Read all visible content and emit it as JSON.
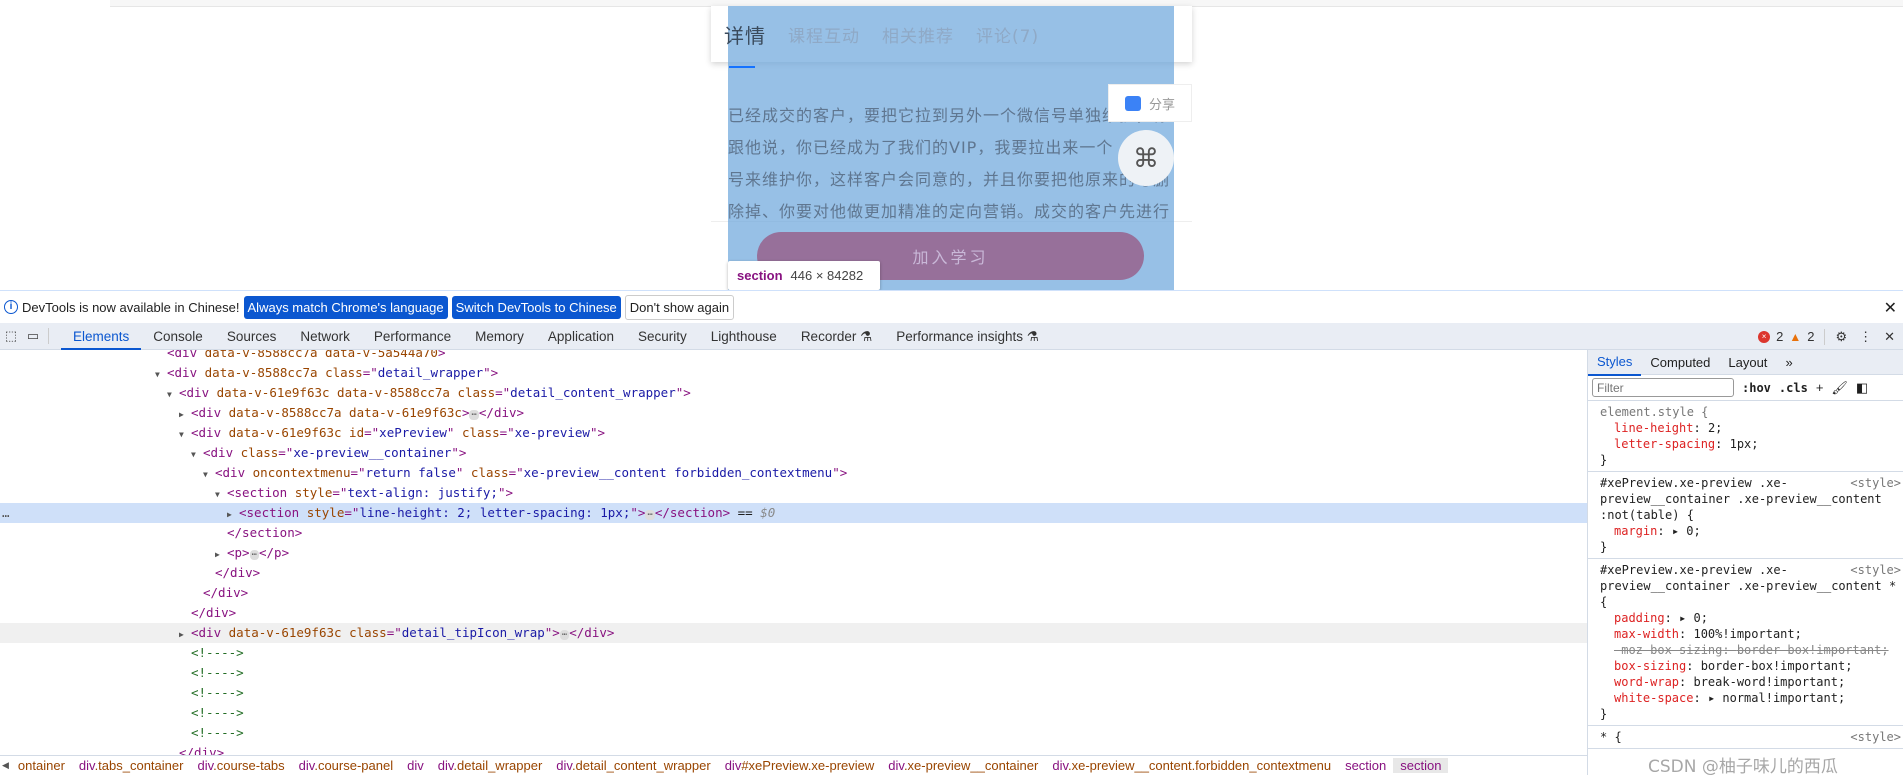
{
  "page": {
    "tabs": [
      "详情",
      "课程互动",
      "相关推荐",
      "评论(7)"
    ],
    "body_lines": [
      "已经成交的客户，要把它拉到另外一个微信号单独维护，你",
      "跟他说，你已经成为了我们的VIP，我要拉出来一个",
      "号来维护你，这样客户会同意的，并且你要把他原来的号删",
      "除掉、你要对他做更加精准的定向营销。成交的客户先进行"
    ],
    "share_label": "分享",
    "join_button": "加入学习",
    "tooltip": {
      "tag": "section",
      "size": "446 × 84282"
    },
    "highlight_color": "#6fa8dc"
  },
  "infobar": {
    "message": "DevTools is now available in Chinese!",
    "buttons": [
      "Always match Chrome's language",
      "Switch DevTools to Chinese",
      "Don't show again"
    ]
  },
  "toolbar": {
    "tabs": [
      "Elements",
      "Console",
      "Sources",
      "Network",
      "Performance",
      "Memory",
      "Application",
      "Security",
      "Lighthouse",
      "Recorder ⚗",
      "Performance insights ⚗"
    ],
    "active": "Elements",
    "errors": "2",
    "warnings": "2"
  },
  "elements": {
    "rows": [
      {
        "i": 10,
        "t": [
          [
            "tag",
            "<div "
          ],
          [
            "an",
            "data-v-8588cc7a data-v-5a544a70"
          ],
          [
            "tag",
            ">"
          ]
        ]
      },
      {
        "i": 10,
        "tri": "▼",
        "t": [
          [
            "tag",
            "<div "
          ],
          [
            "an",
            "data-v-8588cc7a "
          ],
          [
            "an",
            "class"
          ],
          [
            "tag",
            "=\""
          ],
          [
            "av",
            "detail_wrapper"
          ],
          [
            "tag",
            "\">"
          ]
        ]
      },
      {
        "i": 11,
        "tri": "▼",
        "t": [
          [
            "tag",
            "<div "
          ],
          [
            "an",
            "data-v-61e9f63c data-v-8588cc7a "
          ],
          [
            "an",
            "class"
          ],
          [
            "tag",
            "=\""
          ],
          [
            "av",
            "detail_content_wrapper"
          ],
          [
            "tag",
            "\">"
          ]
        ]
      },
      {
        "i": 12,
        "tri": "▶",
        "t": [
          [
            "tag",
            "<div "
          ],
          [
            "an",
            "data-v-8588cc7a data-v-61e9f63c"
          ],
          [
            "tag",
            ">"
          ],
          [
            "ell",
            "⋯"
          ],
          [
            "tag",
            "</div>"
          ]
        ]
      },
      {
        "i": 12,
        "tri": "▼",
        "t": [
          [
            "tag",
            "<div "
          ],
          [
            "an",
            "data-v-61e9f63c id"
          ],
          [
            "tag",
            "=\""
          ],
          [
            "av",
            "xePreview"
          ],
          [
            "tag",
            "\" "
          ],
          [
            "an",
            "class"
          ],
          [
            "tag",
            "=\""
          ],
          [
            "av",
            "xe-preview"
          ],
          [
            "tag",
            "\">"
          ]
        ]
      },
      {
        "i": 13,
        "tri": "▼",
        "t": [
          [
            "tag",
            "<div "
          ],
          [
            "an",
            "class"
          ],
          [
            "tag",
            "=\""
          ],
          [
            "av",
            "xe-preview__container"
          ],
          [
            "tag",
            "\">"
          ]
        ]
      },
      {
        "i": 14,
        "tri": "▼",
        "t": [
          [
            "tag",
            "<div "
          ],
          [
            "an",
            "oncontextmenu"
          ],
          [
            "tag",
            "=\""
          ],
          [
            "av",
            "return false"
          ],
          [
            "tag",
            "\" "
          ],
          [
            "an",
            "class"
          ],
          [
            "tag",
            "=\""
          ],
          [
            "av",
            "xe-preview__content forbidden_contextmenu"
          ],
          [
            "tag",
            "\">"
          ]
        ]
      },
      {
        "i": 15,
        "tri": "▼",
        "t": [
          [
            "tag",
            "<section "
          ],
          [
            "an",
            "style"
          ],
          [
            "tag",
            "=\""
          ],
          [
            "av",
            "text-align: justify;"
          ],
          [
            "tag",
            "\">"
          ]
        ]
      },
      {
        "i": 16,
        "tri": "▶",
        "sel": true,
        "t": [
          [
            "tag",
            "<section "
          ],
          [
            "an",
            "style"
          ],
          [
            "tag",
            "=\""
          ],
          [
            "av",
            "line-height: 2; letter-spacing: 1px;"
          ],
          [
            "tag",
            "\">"
          ],
          [
            "ell",
            "⋯"
          ],
          [
            "tag",
            "</section>"
          ],
          [
            "tx",
            " == "
          ],
          [
            "ref",
            "$0"
          ]
        ]
      },
      {
        "i": 15,
        "t": [
          [
            "tag",
            "</section>"
          ]
        ]
      },
      {
        "i": 15,
        "tri": "▶",
        "t": [
          [
            "tag",
            "<p>"
          ],
          [
            "ell",
            "⋯"
          ],
          [
            "tag",
            "</p>"
          ]
        ]
      },
      {
        "i": 14,
        "t": [
          [
            "tag",
            "</div>"
          ]
        ]
      },
      {
        "i": 13,
        "t": [
          [
            "tag",
            "</div>"
          ]
        ]
      },
      {
        "i": 12,
        "t": [
          [
            "tag",
            "</div>"
          ]
        ]
      },
      {
        "i": 12,
        "tri": "▶",
        "hov": true,
        "t": [
          [
            "tag",
            "<div "
          ],
          [
            "an",
            "data-v-61e9f63c "
          ],
          [
            "an",
            "class"
          ],
          [
            "tag",
            "=\""
          ],
          [
            "av",
            "detail_tipIcon_wrap"
          ],
          [
            "tag",
            "\">"
          ],
          [
            "ell",
            "⋯"
          ],
          [
            "tag",
            "</div>"
          ]
        ]
      },
      {
        "i": 12,
        "t": [
          [
            "cm",
            "<!---->"
          ]
        ]
      },
      {
        "i": 12,
        "t": [
          [
            "cm",
            "<!---->"
          ]
        ]
      },
      {
        "i": 12,
        "t": [
          [
            "cm",
            "<!---->"
          ]
        ]
      },
      {
        "i": 12,
        "t": [
          [
            "cm",
            "<!---->"
          ]
        ]
      },
      {
        "i": 12,
        "t": [
          [
            "cm",
            "<!---->"
          ]
        ]
      },
      {
        "i": 11,
        "t": [
          [
            "tag",
            "</div>"
          ]
        ]
      }
    ]
  },
  "breadcrumb": [
    [
      "",
      "ontainer"
    ],
    [
      "div",
      ".tabs_container"
    ],
    [
      "div",
      ".course-tabs"
    ],
    [
      "div",
      ".course-panel"
    ],
    [
      "div",
      ""
    ],
    [
      "div",
      ".detail_wrapper"
    ],
    [
      "div",
      ".detail_content_wrapper"
    ],
    [
      "div",
      "#xePreview.xe-preview"
    ],
    [
      "div",
      ".xe-preview__container"
    ],
    [
      "div",
      ".xe-preview__content.forbidden_contextmenu"
    ],
    [
      "section",
      ""
    ],
    [
      "section",
      ""
    ]
  ],
  "styles": {
    "tabs": [
      "Styles",
      "Computed",
      "Layout",
      "»"
    ],
    "filter_placeholder": "Filter",
    "hov": ":hov",
    "cls": ".cls",
    "rules": [
      {
        "selector": "element.style {",
        "dim": true,
        "source": "",
        "props": [
          [
            "line-height",
            "2;",
            false
          ],
          [
            "letter-spacing",
            "1px;",
            false
          ]
        ]
      },
      {
        "selector": "#xePreview.xe-preview .xe-preview__container .xe-preview__content :not(table) {",
        "source": "<style>",
        "props": [
          [
            "margin",
            "▸ 0;",
            false
          ]
        ]
      },
      {
        "selector": "#xePreview.xe-preview .xe-preview__container .xe-preview__content * {",
        "source": "<style>",
        "props": [
          [
            "padding",
            "▸ 0;",
            false
          ],
          [
            "max-width",
            "100%!important;",
            false
          ],
          [
            "-moz-box-sizing",
            "border-box!important;",
            true
          ],
          [
            "box-sizing",
            "border-box!important;",
            false
          ],
          [
            "word-wrap",
            "break-word!important;",
            false
          ],
          [
            "white-space",
            "▸ normal!important;",
            false
          ]
        ]
      },
      {
        "selector": "* {",
        "source": "<style>",
        "props": []
      }
    ]
  },
  "watermark": "CSDN @柚子味儿的西瓜"
}
